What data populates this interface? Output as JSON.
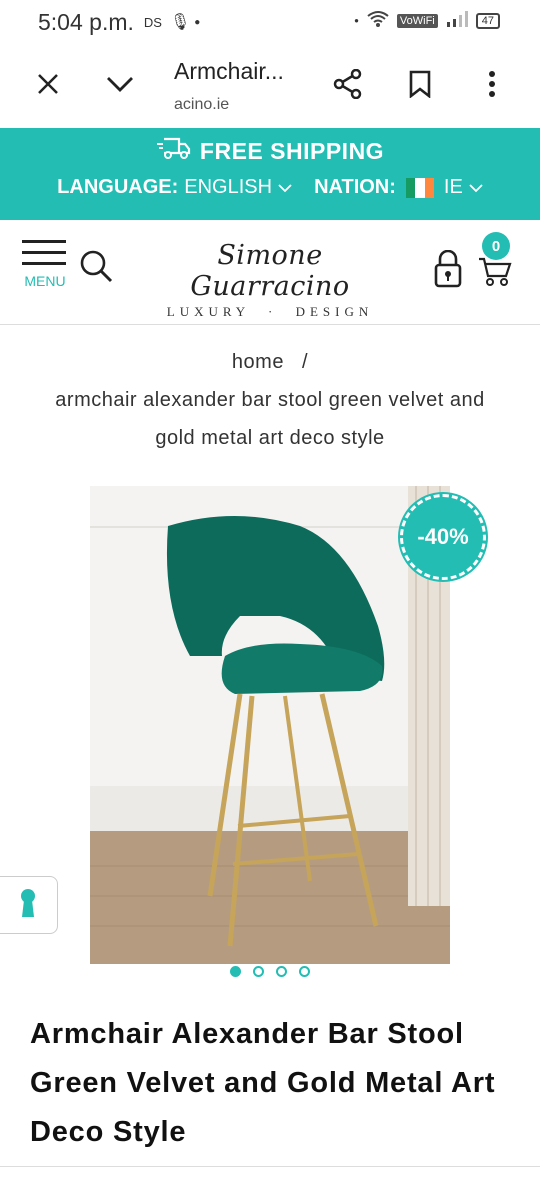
{
  "status_bar": {
    "time": "5:04 p.m.",
    "carrier_tag": "DS",
    "vowifi": "VoWiFi",
    "battery": "47"
  },
  "browser": {
    "tab_title": "Armchair...",
    "url": "acino.ie"
  },
  "promo": {
    "shipping": "FREE SHIPPING",
    "language_label": "LANGUAGE:",
    "language_value": "ENGLISH",
    "nation_label": "NATION:",
    "nation_value": "IE",
    "accent": "#23bdb4"
  },
  "header": {
    "menu_label": "MENU",
    "logo_script": "Simone Guarracino",
    "logo_sub_left": "LUXURY",
    "logo_sub_right": "DESIGN",
    "cart_count": "0"
  },
  "breadcrumb": {
    "home": "home",
    "separator": "/",
    "current_line1": "armchair alexander bar stool green velvet and",
    "current_line2": "gold metal art deco style"
  },
  "product": {
    "discount": "-40%",
    "title": "Armchair Alexander Bar Stool Green Velvet and Gold Metal Art Deco Style",
    "image_count": 4,
    "active_image": 1
  }
}
